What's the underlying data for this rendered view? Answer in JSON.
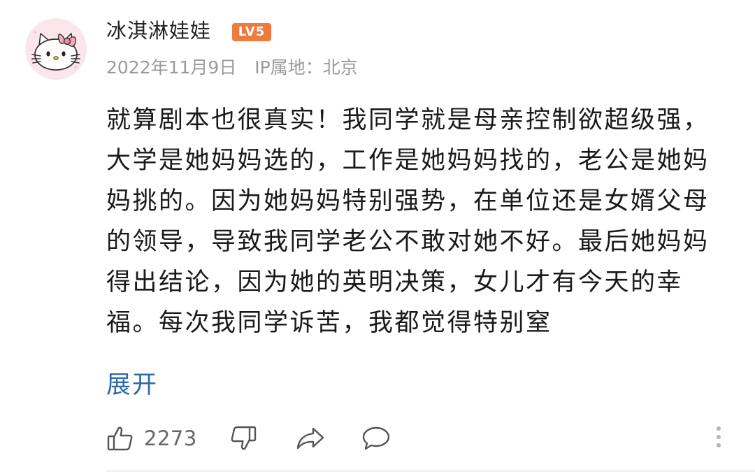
{
  "comment": {
    "user": {
      "name": "冰淇淋娃娃",
      "level_badge": "LV5",
      "avatar_icon": "hello-kitty-avatar"
    },
    "date": "2022年11月9日",
    "ip_location": "IP属地：北京",
    "text": "就算剧本也很真实！我同学就是母亲控制欲超级强，大学是她妈妈选的，工作是她妈妈找的，老公是她妈妈挑的。因为她妈妈特别强势，在单位还是女婿父母的领导，导致我同学老公不敢对她不好。最后她妈妈得出结论，因为她的英明决策，女儿才有今天的幸福。每次我同学诉苦，我都觉得特别窒",
    "expand_label": "展开"
  },
  "actions": {
    "like_count": "2273",
    "like_icon": "thumbs-up-icon",
    "dislike_icon": "thumbs-down-icon",
    "share_icon": "share-icon",
    "reply_icon": "comment-icon",
    "more_icon": "more-vertical-icon"
  },
  "colors": {
    "badge": "#f07a3c",
    "link": "#2e6aa6",
    "meta": "#9a9a9a",
    "icon": "#666666"
  }
}
